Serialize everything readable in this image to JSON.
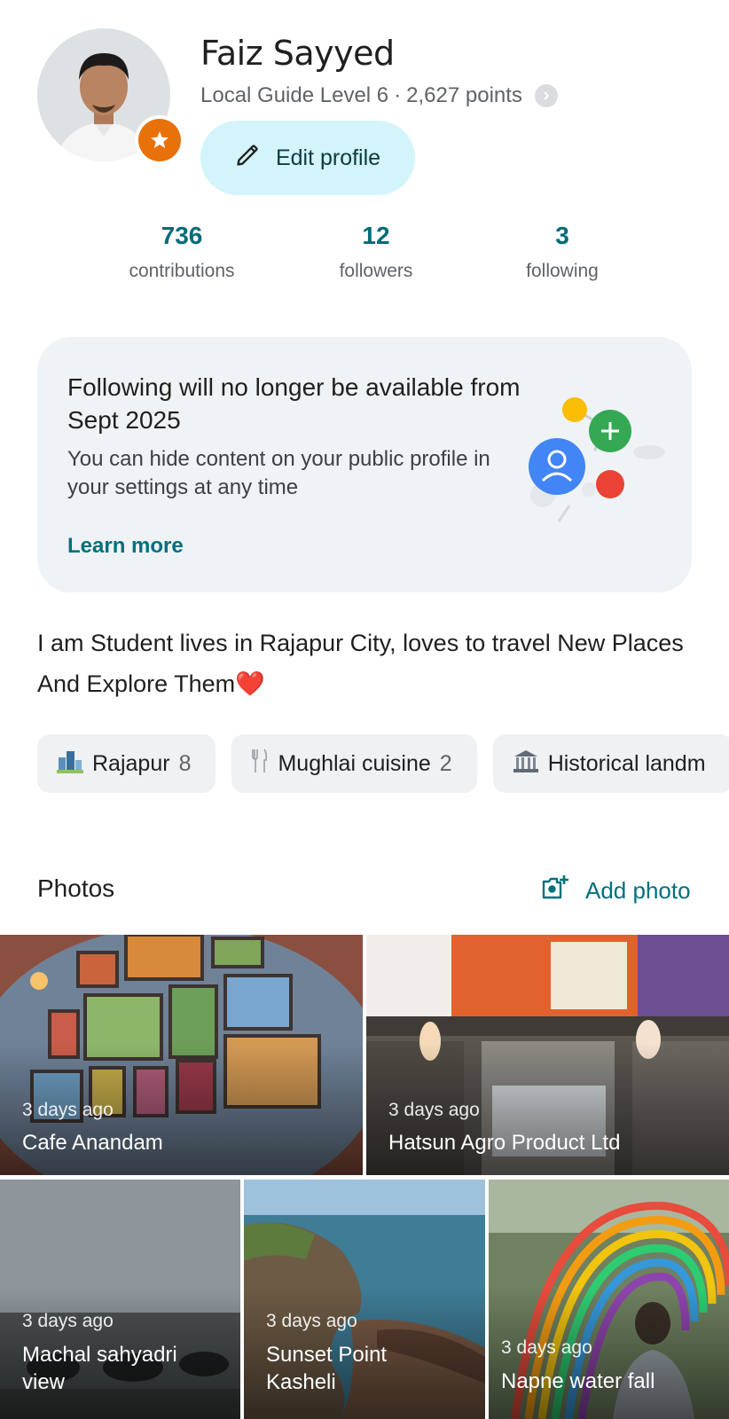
{
  "profile": {
    "name": "Faiz Sayyed",
    "level": "Local Guide Level 6",
    "points": "2,627 points",
    "separator": "·",
    "edit_label": "Edit profile"
  },
  "stats": [
    {
      "value": "736",
      "label": "contributions"
    },
    {
      "value": "12",
      "label": "followers"
    },
    {
      "value": "3",
      "label": "following"
    }
  ],
  "notice": {
    "title": "Following will no longer be available from Sept 2025",
    "body": "You can hide content on your public profile in your settings at any time",
    "link": "Learn more"
  },
  "bio": "I am Student lives in Rajapur City, loves to travel New Places And Explore Them❤️",
  "chips": [
    {
      "label": "Rajapur",
      "count": "8",
      "icon": "city-icon"
    },
    {
      "label": "Mughlai cuisine",
      "count": "2",
      "icon": "fork-knife-icon"
    },
    {
      "label": "Historical landm",
      "icon": "museum-icon"
    }
  ],
  "photos": {
    "title": "Photos",
    "add_label": "Add photo",
    "items": [
      {
        "when": "3 days ago",
        "place": "Cafe Anandam"
      },
      {
        "when": "3 days ago",
        "place": "Hatsun Agro Product Ltd"
      },
      {
        "when": "3 days ago",
        "place_line1": "Machal sahyadri",
        "place_line2": "view"
      },
      {
        "when": "3 days ago",
        "place_line1": "Sunset Point",
        "place_line2": "Kasheli"
      },
      {
        "when": "3 days ago",
        "place": "Napne water fall"
      }
    ]
  },
  "colors": {
    "accent_teal": "#006c7a",
    "edit_button_bg": "#d3f4fb",
    "badge_orange": "#e8710a",
    "card_bg": "#eff3f6"
  }
}
